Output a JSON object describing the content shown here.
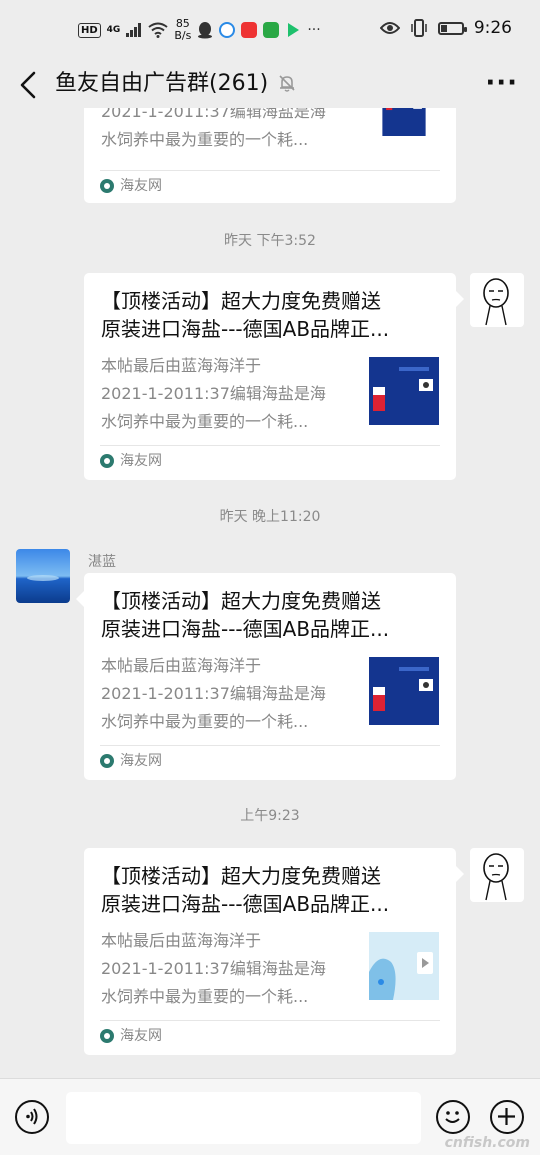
{
  "status_bar": {
    "hd": "HD",
    "network": "4G",
    "speed_value": "85",
    "speed_unit": "B/s",
    "time": "9:26",
    "battery_percent": 30
  },
  "header": {
    "title": "鱼友自由广告群(261)"
  },
  "messages": [
    {
      "title_lines": [
        "",
        ""
      ],
      "desc_lines": [
        "2021-1-2011:37编辑海盐是海",
        "水饲养中最为重要的一个耗..."
      ],
      "source": "海友网"
    },
    {
      "timestamp": "昨天 下午3:52",
      "title_lines": [
        "【顶楼活动】超大力度免费赠送",
        "原装进口海盐---德国AB品牌正..."
      ],
      "desc_lines": [
        "本帖最后由蓝海海洋于",
        "2021-1-2011:37编辑海盐是海",
        "水饲养中最为重要的一个耗..."
      ],
      "source": "海友网"
    },
    {
      "timestamp": "昨天 晚上11:20",
      "sender": "湛蓝",
      "title_lines": [
        "【顶楼活动】超大力度免费赠送",
        "原装进口海盐---德国AB品牌正..."
      ],
      "desc_lines": [
        "本帖最后由蓝海海洋于",
        "2021-1-2011:37编辑海盐是海",
        "水饲养中最为重要的一个耗..."
      ],
      "source": "海友网"
    },
    {
      "timestamp": "上午9:23",
      "title_lines": [
        "【顶楼活动】超大力度免费赠送",
        "原装进口海盐---德国AB品牌正..."
      ],
      "desc_lines": [
        "本帖最后由蓝海海洋于",
        "2021-1-2011:37编辑海盐是海",
        "水饲养中最为重要的一个耗..."
      ],
      "source": "海友网"
    }
  ],
  "watermark": "cnfish.com",
  "colors": {
    "background": "#ededed",
    "card": "#ffffff",
    "muted_text": "#888888"
  }
}
